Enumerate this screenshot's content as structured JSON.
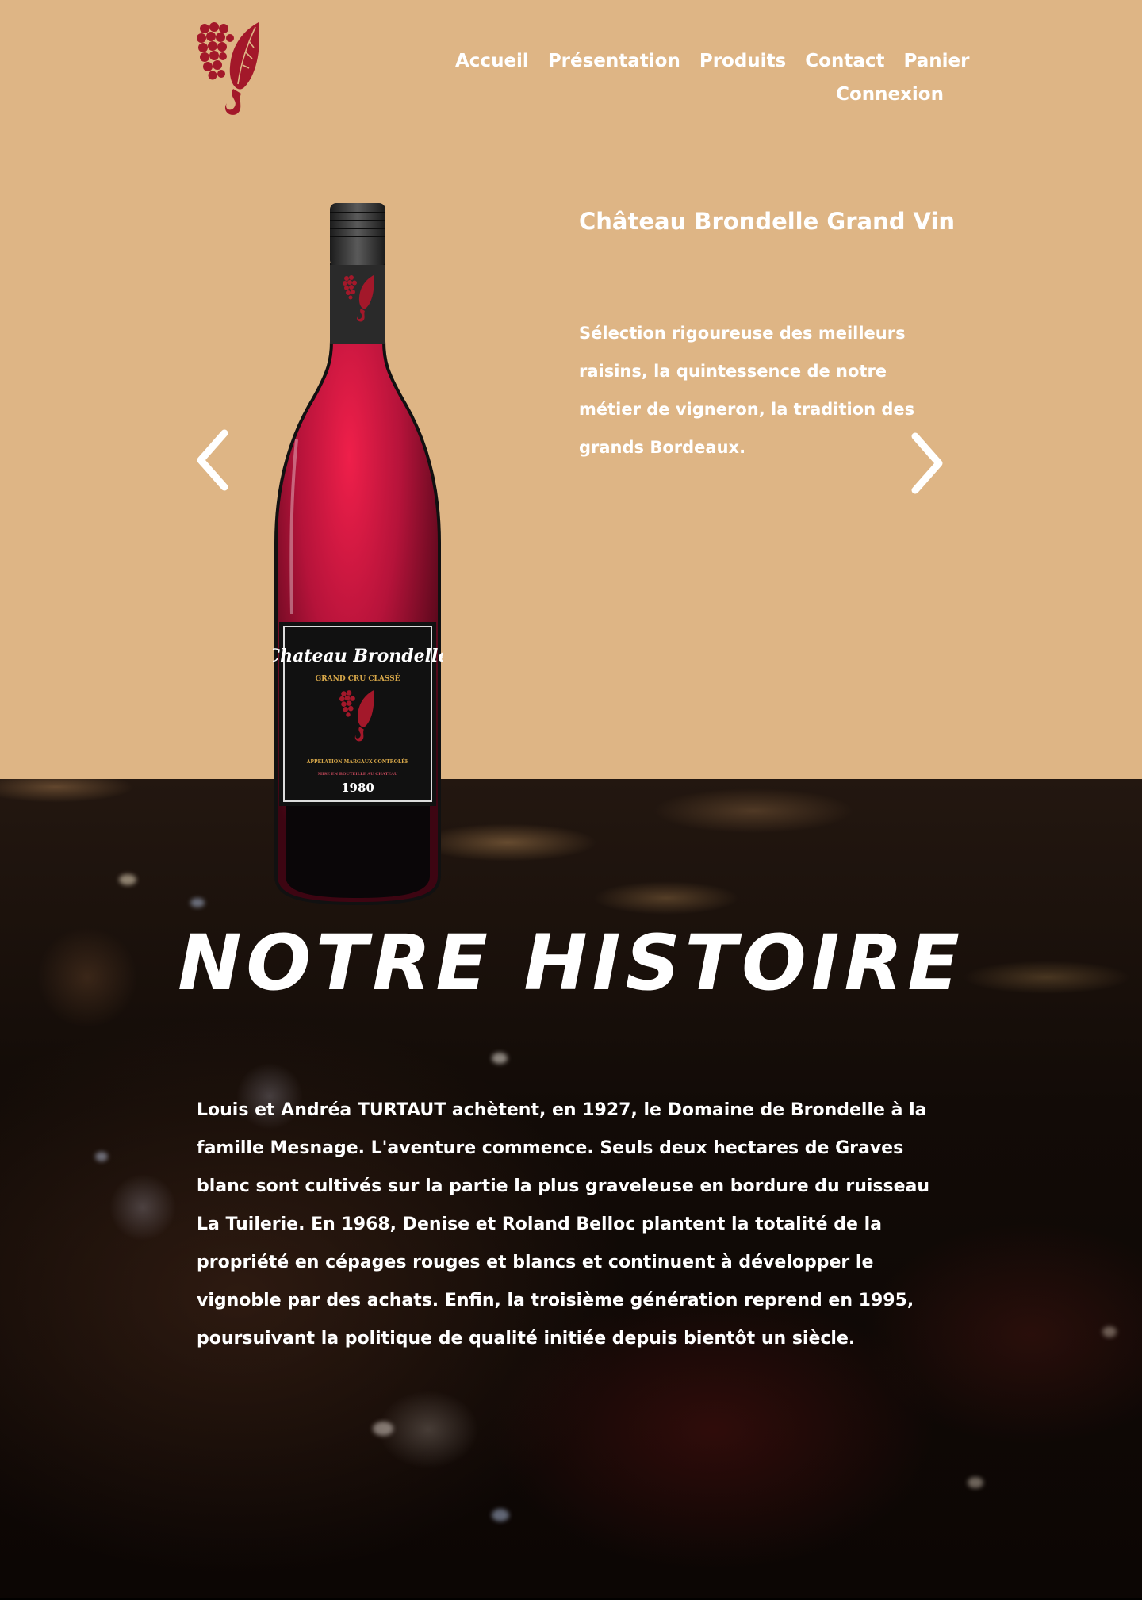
{
  "nav": {
    "items": [
      {
        "label": "Accueil"
      },
      {
        "label": "Présentation"
      },
      {
        "label": "Produits"
      },
      {
        "label": "Contact"
      },
      {
        "label": "Panier"
      }
    ],
    "login_label": "Connexion"
  },
  "hero": {
    "product_title": "Château Brondelle Grand Vin",
    "product_description": "Sélection rigoureuse des meilleurs raisins, la quintessence de notre métier de vigneron, la tradition des grands Bordeaux.",
    "label": {
      "brand": "Chateau Brondelle",
      "classification": "GRAND CRU CLASSÉ",
      "appellation": "APPELATION MARGAUX CONTROLÉE",
      "bottling": "MISE EN BOUTEILLE AU CHATEAU",
      "year": "1980"
    }
  },
  "history": {
    "title": "NOTRE HISTOIRE",
    "text": "Louis et Andréa TURTAUT achètent, en 1927, le Domaine de Brondelle à la famille Mesnage. L'aventure commence. Seuls deux hectares de Graves blanc sont cultivés sur la partie la plus graveleuse en bordure du ruisseau La Tuilerie. En 1968, Denise et Roland Belloc plantent la totalité de la propriété en cépages rouges et blancs et continuent à développer le vignoble par des achats. Enfin, la troisième génération reprend en 1995, poursuivant la politique de qualité initiée depuis bientôt un siècle."
  },
  "icons": {
    "logo": "grape-leaf-logo-icon",
    "prev": "chevron-left-icon",
    "next": "chevron-right-icon"
  },
  "colors": {
    "hero_background": "#deb585",
    "brand_red": "#a3182a",
    "text": "#ffffff"
  }
}
